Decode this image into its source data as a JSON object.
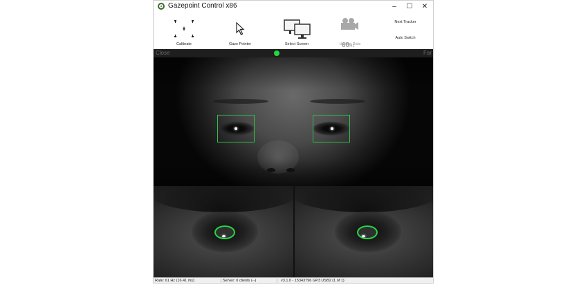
{
  "window": {
    "title": "Gazepoint Control x86",
    "controls": {
      "minimize": "–",
      "maximize": "☐",
      "close": "✕"
    }
  },
  "toolbar": {
    "calibrate": {
      "label": "Calibrate",
      "icon": "calibrate-points-icon"
    },
    "gaze_pointer": {
      "label": "Gaze Pointer",
      "icon": "cursor-icon"
    },
    "select_screen": {
      "label": "Select Screen",
      "icon": "monitors-icon"
    },
    "update_rate": {
      "label": "Update Rate",
      "icon": "camera-icon",
      "value": "60",
      "unit": "Hz",
      "enabled": false
    },
    "next_tracker": "Next Tracker",
    "auto_switch": "Auto Switch"
  },
  "distance_bar": {
    "left_label": "Close",
    "right_label": "Far",
    "indicator_color": "#25d83a"
  },
  "camera": {
    "eye_box_color": "#2ec14a",
    "pupil_outline_color": "#28d447"
  },
  "statusbar": {
    "rate": "Rate: 61 Hz (16.41 ms)",
    "server": "Server: 0 clients (--)",
    "version": "v3.1.0 - 15343796 GP3 USB2 (1 of 1)"
  }
}
